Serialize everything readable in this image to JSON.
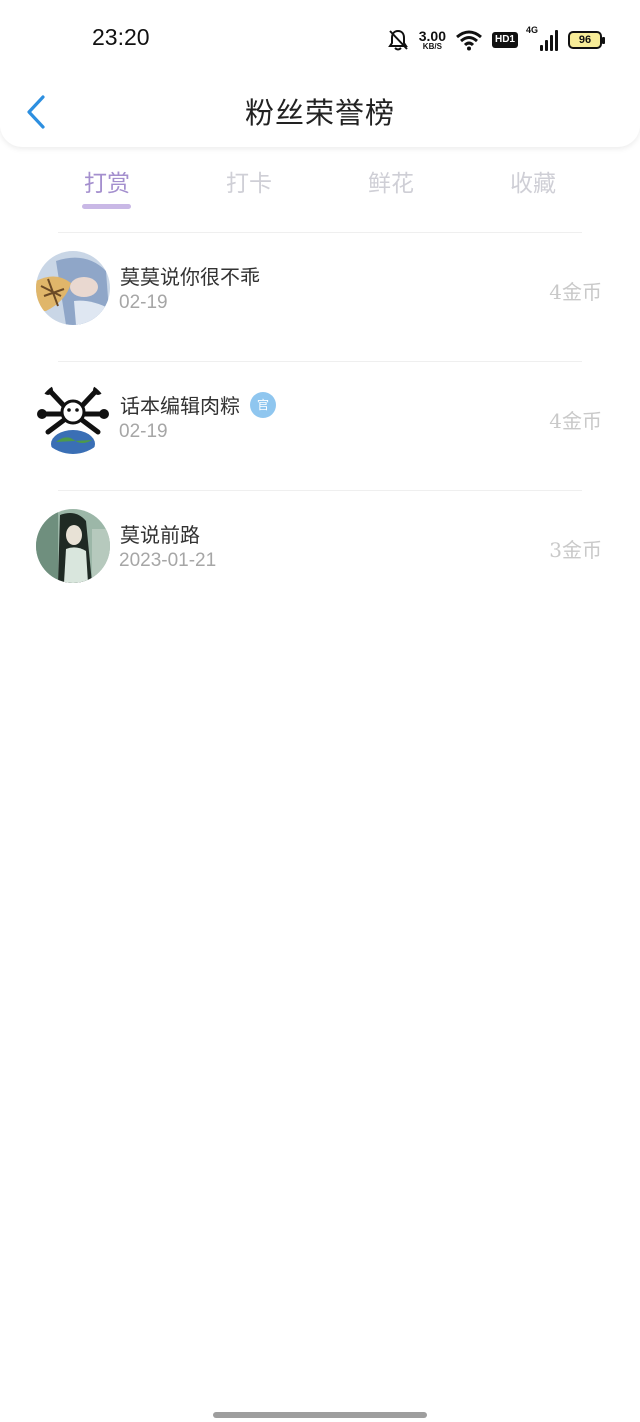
{
  "status_bar": {
    "time": "23:20",
    "net_speed_value": "3.00",
    "net_speed_unit": "KB/S",
    "hd_label": "HD1",
    "signal_label": "4G",
    "battery": "96"
  },
  "header": {
    "title": "粉丝荣誉榜"
  },
  "tabs": [
    {
      "label": "打赏",
      "active": true
    },
    {
      "label": "打卡",
      "active": false
    },
    {
      "label": "鲜花",
      "active": false
    },
    {
      "label": "收藏",
      "active": false
    }
  ],
  "fans": [
    {
      "name": "莫莫说你很不乖",
      "date": "02-19",
      "amount": "4金币",
      "badge": ""
    },
    {
      "name": "话本编辑肉粽",
      "date": "02-19",
      "amount": "4金币",
      "badge": "官"
    },
    {
      "name": "莫说前路",
      "date": "2023-01-21",
      "amount": "3金币",
      "badge": ""
    }
  ],
  "colors": {
    "accent": "#a48fce",
    "indicator": "#c9b8e6",
    "back_arrow": "#2d8fe0",
    "badge": "#8fc6ef"
  }
}
